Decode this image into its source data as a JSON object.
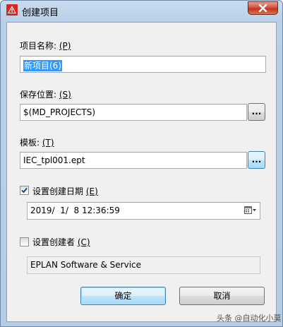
{
  "window": {
    "title": "创建项目"
  },
  "project_name": {
    "label": "项目名称:",
    "accel": "(P)",
    "value": "新项目(6)"
  },
  "save_location": {
    "label": "保存位置:",
    "accel": "(S)",
    "value": "$(MD_PROJECTS)",
    "browse_label": "..."
  },
  "template": {
    "label": "模板:",
    "accel": "(T)",
    "value": "IEC_tpl001.ept",
    "browse_label": "..."
  },
  "creation_date": {
    "checkbox_label": "设置创建日期",
    "accel": "(E)",
    "checked": true,
    "value": "2019/  1/  8 12:36:59"
  },
  "creator": {
    "checkbox_label": "设置创建者",
    "accel": "(C)",
    "checked": false,
    "value": "EPLAN Software & Service"
  },
  "buttons": {
    "ok": "确定",
    "cancel": "取消"
  },
  "watermark": "头条 @自动化小莫"
}
